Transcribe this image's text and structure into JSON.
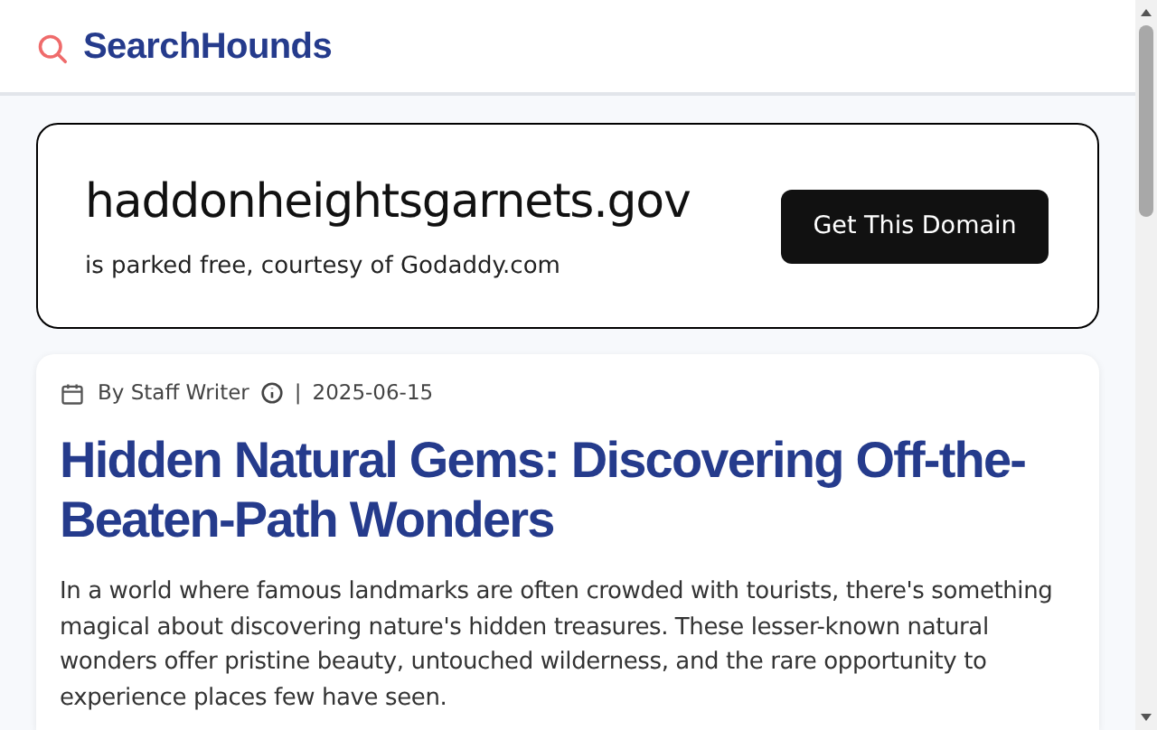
{
  "header": {
    "logo": "SearchHounds"
  },
  "domain_card": {
    "domain": "haddonheightsgarnets.gov",
    "subtitle": "is parked free, courtesy of Godaddy.com",
    "button": "Get This Domain"
  },
  "article": {
    "author": "By Staff Writer",
    "separator": "|",
    "date": "2025-06-15",
    "title": "Hidden Natural Gems: Discovering Off-the-Beaten-Path Wonders",
    "body": "In a world where famous landmarks are often crowded with tourists, there's something magical about discovering nature's hidden treasures. These lesser-known natural wonders offer pristine beauty, untouched wilderness, and the rare opportunity to experience places few have seen."
  }
}
